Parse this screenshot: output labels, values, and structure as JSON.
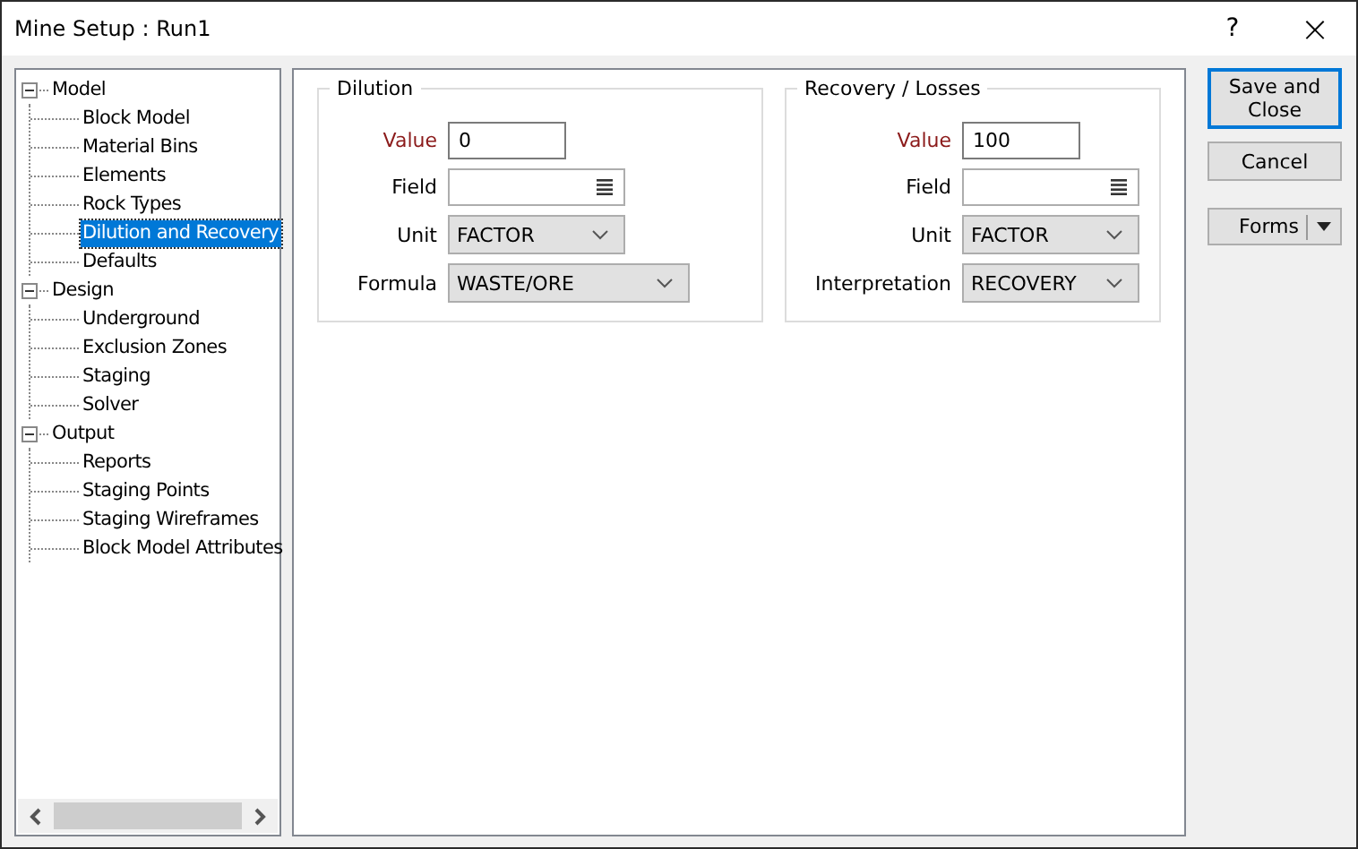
{
  "window": {
    "title": "Mine Setup : Run1",
    "help": "?",
    "close": "×"
  },
  "tree": [
    {
      "label": "Model",
      "expanded": true,
      "selected": false,
      "children": [
        {
          "label": "Block Model",
          "selected": false
        },
        {
          "label": "Material Bins",
          "selected": false
        },
        {
          "label": "Elements",
          "selected": false
        },
        {
          "label": "Rock Types",
          "selected": false
        },
        {
          "label": "Dilution and Recovery",
          "selected": true
        },
        {
          "label": "Defaults",
          "selected": false
        }
      ]
    },
    {
      "label": "Design",
      "expanded": true,
      "selected": false,
      "children": [
        {
          "label": "Underground",
          "selected": false
        },
        {
          "label": "Exclusion Zones",
          "selected": false
        },
        {
          "label": "Staging",
          "selected": false
        },
        {
          "label": "Solver",
          "selected": false
        }
      ]
    },
    {
      "label": "Output",
      "expanded": true,
      "selected": false,
      "children": [
        {
          "label": "Reports",
          "selected": false
        },
        {
          "label": "Staging Points",
          "selected": false
        },
        {
          "label": "Staging Wireframes",
          "selected": false
        },
        {
          "label": "Block Model Attributes",
          "selected": false
        }
      ]
    }
  ],
  "groups": [
    {
      "title": "Dilution",
      "fields": [
        {
          "label": "Value",
          "kind": "text",
          "required": true,
          "value": "0"
        },
        {
          "label": "Field",
          "kind": "picker",
          "required": false
        },
        {
          "label": "Unit",
          "kind": "combo",
          "required": false,
          "value": "FACTOR"
        },
        {
          "label": "Formula",
          "kind": "combo",
          "required": false,
          "value": "WASTE/ORE"
        }
      ]
    },
    {
      "title": "Recovery / Losses",
      "fields": [
        {
          "label": "Value",
          "kind": "text",
          "required": true,
          "value": "100"
        },
        {
          "label": "Field",
          "kind": "picker",
          "required": false
        },
        {
          "label": "Unit",
          "kind": "combo",
          "required": false,
          "value": "FACTOR"
        },
        {
          "label": "Interpretation",
          "kind": "combo",
          "required": false,
          "value": "RECOVERY"
        }
      ]
    }
  ],
  "buttons": [
    {
      "label": "Save and Close",
      "kind": "default"
    },
    {
      "label": "Cancel",
      "kind": "normal"
    },
    {
      "label": "Forms",
      "kind": "split"
    }
  ]
}
